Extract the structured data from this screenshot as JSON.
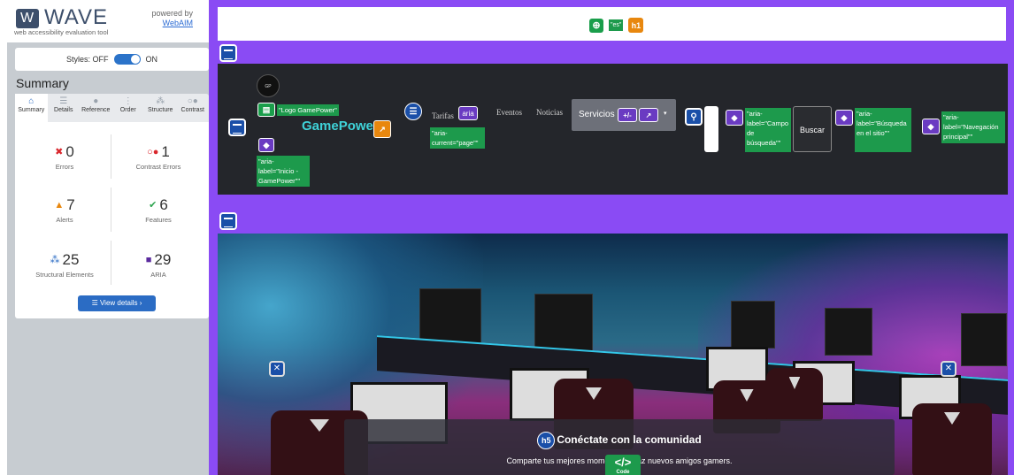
{
  "wave": {
    "logo": "WAVE",
    "tagline": "web accessibility evaluation tool",
    "powered_by": "powered by",
    "webaim": "WebAIM",
    "styles_off": "Styles: OFF",
    "styles_on": "ON",
    "summary_title": "Summary",
    "tabs": [
      {
        "label": "Summary",
        "icon": "home-icon"
      },
      {
        "label": "Details",
        "icon": "list-icon"
      },
      {
        "label": "Reference",
        "icon": "info-icon"
      },
      {
        "label": "Order",
        "icon": "order-icon"
      },
      {
        "label": "Structure",
        "icon": "structure-icon"
      },
      {
        "label": "Contrast",
        "icon": "contrast-icon"
      }
    ],
    "stats": {
      "errors": {
        "count": "0",
        "label": "Errors"
      },
      "contrast": {
        "count": "1",
        "label": "Contrast Errors"
      },
      "alerts": {
        "count": "7",
        "label": "Alerts"
      },
      "features": {
        "count": "6",
        "label": "Features"
      },
      "structural": {
        "count": "25",
        "label": "Structural Elements"
      },
      "aria": {
        "count": "29",
        "label": "ARIA"
      }
    },
    "view_details": "View details ›"
  },
  "page": {
    "top_lang_label": "\"es\"",
    "top_h1": "h1",
    "logo_label": "\"Logo GamePower\"",
    "logo_aria": "\"aria-label=\"Inicio - GamePower\"\"",
    "brand": "GamePower",
    "nav_links": [
      "Tarifas",
      "Eventos",
      "Noticias"
    ],
    "aria_badge": "aria",
    "aria_current": "\"aria-current=\"page\"\"",
    "servicios": "Servicios",
    "search_aria": "\"aria-label=\"Campo de búsqueda\"\"",
    "buscar": "Buscar",
    "search_site_aria": "\"aria-label=\"Búsqueda en el sitio\"\"",
    "nav_aria": "\"aria-label=\"Navegación principal\"\"",
    "h5": "h5",
    "hero_title": "Conéctate con la comunidad",
    "hero_text": "Comparte tus mejores momentos y haz nuevos amigos gamers.",
    "code_badge": "</>",
    "code_label": "Code"
  },
  "colors": {
    "purple": "#8a4bf4",
    "wave_blue": "#2b6cc4",
    "aria_green": "#1d9a4c"
  }
}
